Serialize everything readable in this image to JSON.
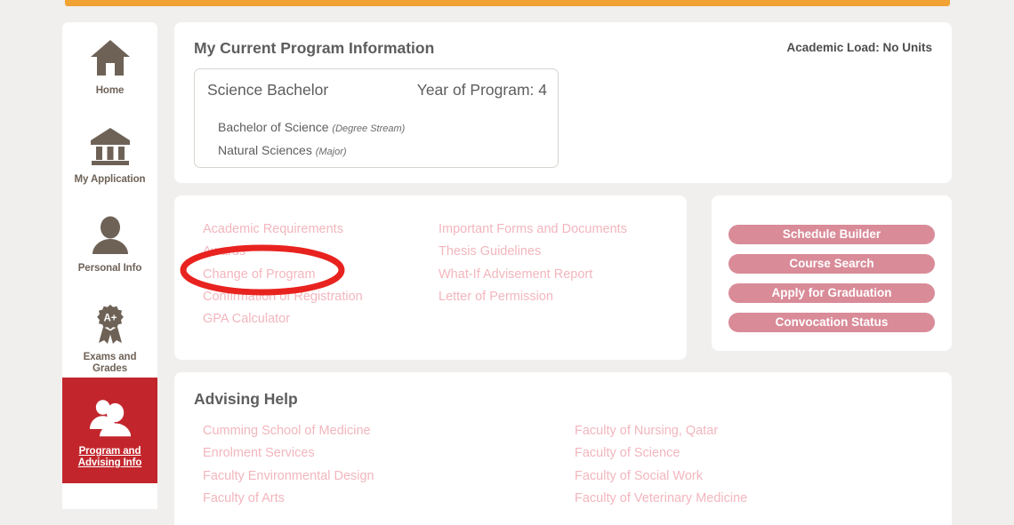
{
  "accent_colors": {
    "top_bar_orange": "#f0a232",
    "active_sidebar_red": "#c2262c",
    "button_rose": "#d98b98",
    "link_pink": "#f2b6bd",
    "annotation_red": "#e8231f",
    "page_background": "#f0efed",
    "card_white": "#ffffff",
    "heading_gray": "#5d5d5d"
  },
  "sidebar": {
    "items": [
      {
        "label": "Home",
        "icon": "home-icon",
        "active": false
      },
      {
        "label": "My Application",
        "icon": "bank-building-icon",
        "active": false
      },
      {
        "label": "Personal Info",
        "icon": "person-icon",
        "active": false
      },
      {
        "label": "Exams and\nGrades",
        "label_line1": "Exams and",
        "label_line2": "Grades",
        "icon": "award-ribbon-icon",
        "active": false
      },
      {
        "label": "Program and\nAdvising Info",
        "label_line1": "Program and",
        "label_line2": "Advising Info",
        "icon": "two-people-icon",
        "active": true
      }
    ]
  },
  "program_card": {
    "heading": "My Current Program Information",
    "academic_load": "Academic Load: No Units",
    "program_name": "Science Bachelor",
    "year_of_program": "Year of Program: 4",
    "rows": [
      {
        "text": "Bachelor of Science",
        "note": "(Degree Stream)"
      },
      {
        "text": "Natural Sciences",
        "note": "(Major)"
      }
    ]
  },
  "links_card": {
    "column_1": [
      "Academic Requirements",
      "Awards",
      "Change of Program",
      "Confirmation of Registration",
      "GPA Calculator"
    ],
    "column_2": [
      "Important Forms and Documents",
      "Thesis Guidelines",
      "What-If Advisement Report",
      "Letter of Permission"
    ]
  },
  "actions_card": {
    "buttons": [
      "Schedule Builder",
      "Course Search",
      "Apply for Graduation",
      "Convocation Status"
    ]
  },
  "advising_card": {
    "heading": "Advising Help",
    "column_1": [
      "Cumming School of Medicine",
      "Enrolment Services",
      "Faculty Environmental Design",
      "Faculty of Arts"
    ],
    "column_2": [
      "Faculty of Nursing, Qatar",
      "Faculty of Science",
      "Faculty of Social Work",
      "Faculty of Veterinary Medicine"
    ]
  },
  "annotation": {
    "shape": "ellipse",
    "target_link": "Change of Program"
  }
}
